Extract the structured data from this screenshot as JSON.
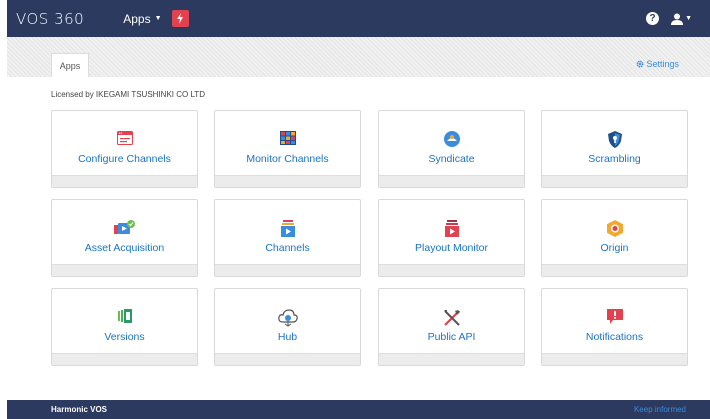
{
  "navbar": {
    "brand": "VOS 360",
    "apps_label": "Apps",
    "help_icon": "question-circle-icon",
    "user_icon": "user-icon"
  },
  "tabs": {
    "apps": "Apps"
  },
  "settings_label": "Settings",
  "licensed_text": "Licensed by IKEGAMI TSUSHINKI CO LTD",
  "apps": [
    {
      "label": "Configure Channels",
      "icon": "configure-channels-icon"
    },
    {
      "label": "Monitor Channels",
      "icon": "monitor-channels-icon"
    },
    {
      "label": "Syndicate",
      "icon": "syndicate-icon"
    },
    {
      "label": "Scrambling",
      "icon": "scrambling-icon"
    },
    {
      "label": "Asset Acquisition",
      "icon": "asset-acquisition-icon"
    },
    {
      "label": "Channels",
      "icon": "channels-icon"
    },
    {
      "label": "Playout Monitor",
      "icon": "playout-monitor-icon"
    },
    {
      "label": "Origin",
      "icon": "origin-icon"
    },
    {
      "label": "Versions",
      "icon": "versions-icon"
    },
    {
      "label": "Hub",
      "icon": "hub-icon"
    },
    {
      "label": "Public API",
      "icon": "public-api-icon"
    },
    {
      "label": "Notifications",
      "icon": "notifications-icon"
    }
  ],
  "footer": {
    "left": "Harmonic VOS",
    "right": "Keep informed"
  },
  "colors": {
    "navbar": "#2b3a5e",
    "link": "#1a73c8",
    "accent_red": "#e2424f"
  }
}
